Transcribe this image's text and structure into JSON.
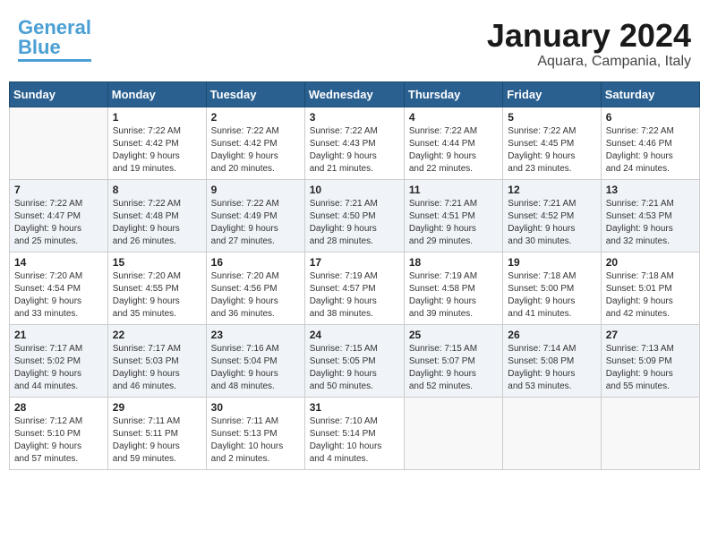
{
  "header": {
    "logo_general": "General",
    "logo_blue": "Blue",
    "month": "January 2024",
    "location": "Aquara, Campania, Italy"
  },
  "weekdays": [
    "Sunday",
    "Monday",
    "Tuesday",
    "Wednesday",
    "Thursday",
    "Friday",
    "Saturday"
  ],
  "weeks": [
    [
      {
        "day": "",
        "info": ""
      },
      {
        "day": "1",
        "info": "Sunrise: 7:22 AM\nSunset: 4:42 PM\nDaylight: 9 hours\nand 19 minutes."
      },
      {
        "day": "2",
        "info": "Sunrise: 7:22 AM\nSunset: 4:42 PM\nDaylight: 9 hours\nand 20 minutes."
      },
      {
        "day": "3",
        "info": "Sunrise: 7:22 AM\nSunset: 4:43 PM\nDaylight: 9 hours\nand 21 minutes."
      },
      {
        "day": "4",
        "info": "Sunrise: 7:22 AM\nSunset: 4:44 PM\nDaylight: 9 hours\nand 22 minutes."
      },
      {
        "day": "5",
        "info": "Sunrise: 7:22 AM\nSunset: 4:45 PM\nDaylight: 9 hours\nand 23 minutes."
      },
      {
        "day": "6",
        "info": "Sunrise: 7:22 AM\nSunset: 4:46 PM\nDaylight: 9 hours\nand 24 minutes."
      }
    ],
    [
      {
        "day": "7",
        "info": "Sunrise: 7:22 AM\nSunset: 4:47 PM\nDaylight: 9 hours\nand 25 minutes."
      },
      {
        "day": "8",
        "info": "Sunrise: 7:22 AM\nSunset: 4:48 PM\nDaylight: 9 hours\nand 26 minutes."
      },
      {
        "day": "9",
        "info": "Sunrise: 7:22 AM\nSunset: 4:49 PM\nDaylight: 9 hours\nand 27 minutes."
      },
      {
        "day": "10",
        "info": "Sunrise: 7:21 AM\nSunset: 4:50 PM\nDaylight: 9 hours\nand 28 minutes."
      },
      {
        "day": "11",
        "info": "Sunrise: 7:21 AM\nSunset: 4:51 PM\nDaylight: 9 hours\nand 29 minutes."
      },
      {
        "day": "12",
        "info": "Sunrise: 7:21 AM\nSunset: 4:52 PM\nDaylight: 9 hours\nand 30 minutes."
      },
      {
        "day": "13",
        "info": "Sunrise: 7:21 AM\nSunset: 4:53 PM\nDaylight: 9 hours\nand 32 minutes."
      }
    ],
    [
      {
        "day": "14",
        "info": "Sunrise: 7:20 AM\nSunset: 4:54 PM\nDaylight: 9 hours\nand 33 minutes."
      },
      {
        "day": "15",
        "info": "Sunrise: 7:20 AM\nSunset: 4:55 PM\nDaylight: 9 hours\nand 35 minutes."
      },
      {
        "day": "16",
        "info": "Sunrise: 7:20 AM\nSunset: 4:56 PM\nDaylight: 9 hours\nand 36 minutes."
      },
      {
        "day": "17",
        "info": "Sunrise: 7:19 AM\nSunset: 4:57 PM\nDaylight: 9 hours\nand 38 minutes."
      },
      {
        "day": "18",
        "info": "Sunrise: 7:19 AM\nSunset: 4:58 PM\nDaylight: 9 hours\nand 39 minutes."
      },
      {
        "day": "19",
        "info": "Sunrise: 7:18 AM\nSunset: 5:00 PM\nDaylight: 9 hours\nand 41 minutes."
      },
      {
        "day": "20",
        "info": "Sunrise: 7:18 AM\nSunset: 5:01 PM\nDaylight: 9 hours\nand 42 minutes."
      }
    ],
    [
      {
        "day": "21",
        "info": "Sunrise: 7:17 AM\nSunset: 5:02 PM\nDaylight: 9 hours\nand 44 minutes."
      },
      {
        "day": "22",
        "info": "Sunrise: 7:17 AM\nSunset: 5:03 PM\nDaylight: 9 hours\nand 46 minutes."
      },
      {
        "day": "23",
        "info": "Sunrise: 7:16 AM\nSunset: 5:04 PM\nDaylight: 9 hours\nand 48 minutes."
      },
      {
        "day": "24",
        "info": "Sunrise: 7:15 AM\nSunset: 5:05 PM\nDaylight: 9 hours\nand 50 minutes."
      },
      {
        "day": "25",
        "info": "Sunrise: 7:15 AM\nSunset: 5:07 PM\nDaylight: 9 hours\nand 52 minutes."
      },
      {
        "day": "26",
        "info": "Sunrise: 7:14 AM\nSunset: 5:08 PM\nDaylight: 9 hours\nand 53 minutes."
      },
      {
        "day": "27",
        "info": "Sunrise: 7:13 AM\nSunset: 5:09 PM\nDaylight: 9 hours\nand 55 minutes."
      }
    ],
    [
      {
        "day": "28",
        "info": "Sunrise: 7:12 AM\nSunset: 5:10 PM\nDaylight: 9 hours\nand 57 minutes."
      },
      {
        "day": "29",
        "info": "Sunrise: 7:11 AM\nSunset: 5:11 PM\nDaylight: 9 hours\nand 59 minutes."
      },
      {
        "day": "30",
        "info": "Sunrise: 7:11 AM\nSunset: 5:13 PM\nDaylight: 10 hours\nand 2 minutes."
      },
      {
        "day": "31",
        "info": "Sunrise: 7:10 AM\nSunset: 5:14 PM\nDaylight: 10 hours\nand 4 minutes."
      },
      {
        "day": "",
        "info": ""
      },
      {
        "day": "",
        "info": ""
      },
      {
        "day": "",
        "info": ""
      }
    ]
  ]
}
